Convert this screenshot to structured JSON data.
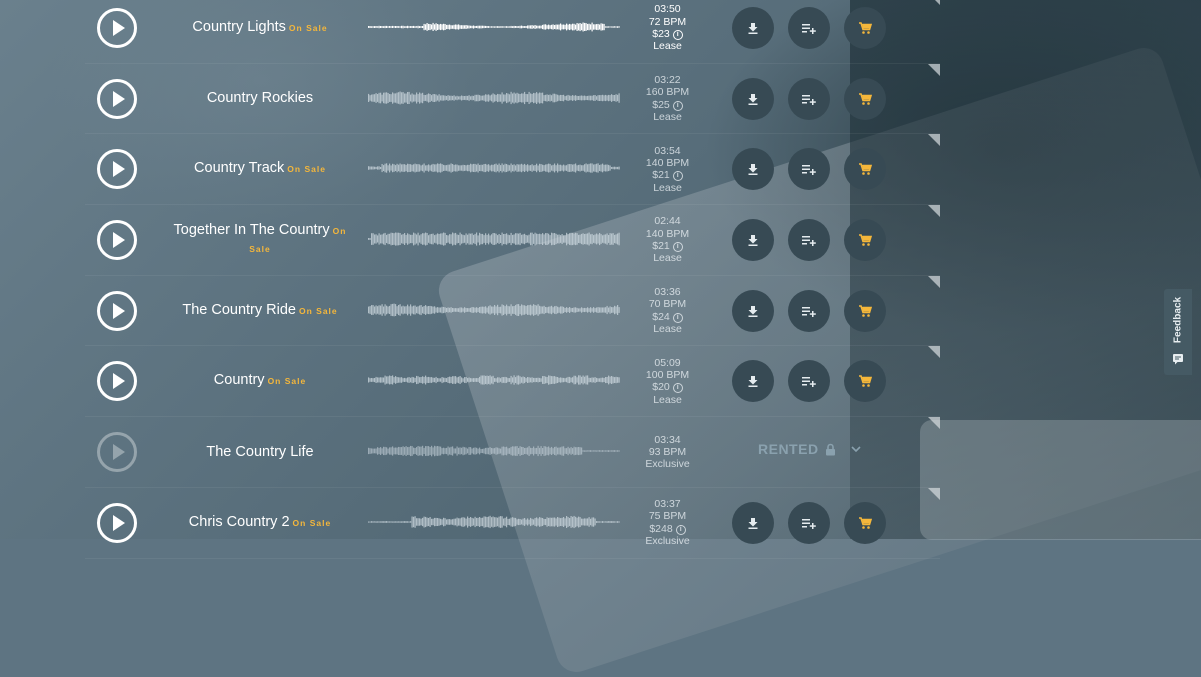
{
  "sale_label": "On Sale",
  "colors": {
    "accent": "#f5b73b",
    "button_bg": "#374a54",
    "text": "#ffffff"
  },
  "tracks": [
    {
      "title": "Country Lights",
      "on_sale": true,
      "duration": "03:50",
      "bpm": "72 BPM",
      "price": "$23",
      "license": "Lease",
      "highlighted": true,
      "status": "active"
    },
    {
      "title": "Country Rockies",
      "on_sale": false,
      "duration": "03:22",
      "bpm": "160 BPM",
      "price": "$25",
      "license": "Lease",
      "status": "active"
    },
    {
      "title": "Country Track",
      "on_sale": true,
      "duration": "03:54",
      "bpm": "140 BPM",
      "price": "$21",
      "license": "Lease",
      "status": "active"
    },
    {
      "title": "Together In The Country",
      "on_sale": true,
      "duration": "02:44",
      "bpm": "140 BPM",
      "price": "$21",
      "license": "Lease",
      "status": "active"
    },
    {
      "title": "The Country Ride",
      "on_sale": true,
      "duration": "03:36",
      "bpm": "70 BPM",
      "price": "$24",
      "license": "Lease",
      "status": "active"
    },
    {
      "title": "Country",
      "on_sale": true,
      "duration": "05:09",
      "bpm": "100 BPM",
      "price": "$20",
      "license": "Lease",
      "status": "active"
    },
    {
      "title": "The Country Life",
      "on_sale": false,
      "duration": "03:34",
      "bpm": "93 BPM",
      "price": "",
      "license": "Exclusive",
      "status": "rented",
      "rented_label": "RENTED"
    },
    {
      "title": "Chris Country 2",
      "on_sale": true,
      "duration": "03:37",
      "bpm": "75 BPM",
      "price": "$248",
      "license": "Exclusive",
      "status": "active"
    }
  ],
  "icons": {
    "play": "play-icon",
    "download": "download-icon",
    "playlist": "add-to-playlist-icon",
    "cart": "cart-icon",
    "info": "info-icon",
    "lock": "lock-icon",
    "chevron": "chevron-down-icon"
  },
  "feedback_label": "Feedback"
}
